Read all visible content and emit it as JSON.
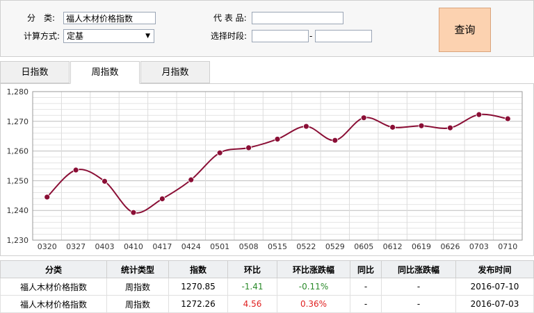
{
  "filter": {
    "category_label": "分　类:",
    "category_value": "福人木材价格指数",
    "code_label": "代 表 品:",
    "code_value": "",
    "method_label": "计算方式:",
    "method_value": "定基",
    "period_label": "选择时段:",
    "period_start": "",
    "period_end": "",
    "period_sep": "-",
    "query_button": "查询"
  },
  "tabs": [
    {
      "label": "日指数",
      "active": false
    },
    {
      "label": "周指数",
      "active": true
    },
    {
      "label": "月指数",
      "active": false
    }
  ],
  "chart_data": {
    "type": "line",
    "x": [
      "0320",
      "0327",
      "0403",
      "0410",
      "0417",
      "0424",
      "0501",
      "0508",
      "0515",
      "0522",
      "0529",
      "0605",
      "0612",
      "0619",
      "0626",
      "0703",
      "0710"
    ],
    "series": [
      {
        "values": [
          1244.5,
          1253.6,
          1249.8,
          1239.3,
          1243.9,
          1250.3,
          1259.4,
          1261.1,
          1264.0,
          1268.3,
          1263.6,
          1271.2,
          1268.0,
          1268.5,
          1267.8,
          1272.26,
          1270.85
        ]
      }
    ],
    "yticks": [
      "1,230",
      "1,240",
      "1,250",
      "1,260",
      "1,270",
      "1,280"
    ],
    "ylim": [
      1230,
      1280
    ],
    "grid": true,
    "line_color": "#8a0e35"
  },
  "table": {
    "headers": [
      "分类",
      "统计类型",
      "指数",
      "环比",
      "环比涨跌幅",
      "同比",
      "同比涨跌幅",
      "发布时间"
    ],
    "rows": [
      {
        "cells": [
          "福人木材价格指数",
          "周指数",
          "1270.85",
          "-1.41",
          "-0.11%",
          "-",
          "-",
          "2016-07-10"
        ],
        "trend": "down"
      },
      {
        "cells": [
          "福人木材价格指数",
          "周指数",
          "1272.26",
          "4.56",
          "0.36%",
          "-",
          "-",
          "2016-07-03"
        ],
        "trend": "up"
      }
    ],
    "colors": {
      "up": "#e02020",
      "down": "#2a8a2a"
    }
  }
}
